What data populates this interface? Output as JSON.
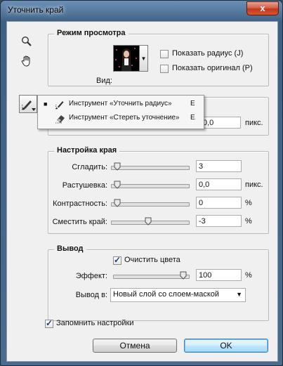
{
  "window": {
    "title": "Уточнить край",
    "close_glyph": "x"
  },
  "view_mode": {
    "title": "Режим просмотра",
    "view_label": "Вид:",
    "show_radius": {
      "label": "Показать радиус (J)",
      "checked": false
    },
    "show_original": {
      "label": "Показать оригинал (P)",
      "checked": false
    }
  },
  "edge_detection": {
    "radius_value": "0,0",
    "radius_unit": "пикс."
  },
  "tool_menu": {
    "items": [
      {
        "label": "Инструмент «Уточнить радиус»",
        "key": "E",
        "selected": true
      },
      {
        "label": "Инструмент «Стереть уточнение»",
        "key": "E",
        "selected": false
      }
    ]
  },
  "adjust_edge": {
    "title": "Настройка края",
    "rows": [
      {
        "label": "Сгладить:",
        "value": "3",
        "unit": "",
        "level": 0.0
      },
      {
        "label": "Растушевка:",
        "value": "0,0",
        "unit": "пикс.",
        "level": 0.0
      },
      {
        "label": "Контрастность:",
        "value": "0",
        "unit": "%",
        "level": 0.0
      },
      {
        "label": "Сместить край:",
        "value": "-3",
        "unit": "%",
        "level": 0.47
      }
    ]
  },
  "output": {
    "title": "Вывод",
    "decontaminate": {
      "label": "Очистить цвета",
      "checked": true
    },
    "amount": {
      "label": "Эффект:",
      "value": "100",
      "unit": "%",
      "level": 1.0
    },
    "output_to": {
      "label": "Вывод в:",
      "value": "Новый слой со слоем-маской"
    }
  },
  "remember": {
    "label": "Запомнить настройки",
    "checked": true
  },
  "buttons": {
    "cancel": "Отмена",
    "ok": "OK"
  }
}
